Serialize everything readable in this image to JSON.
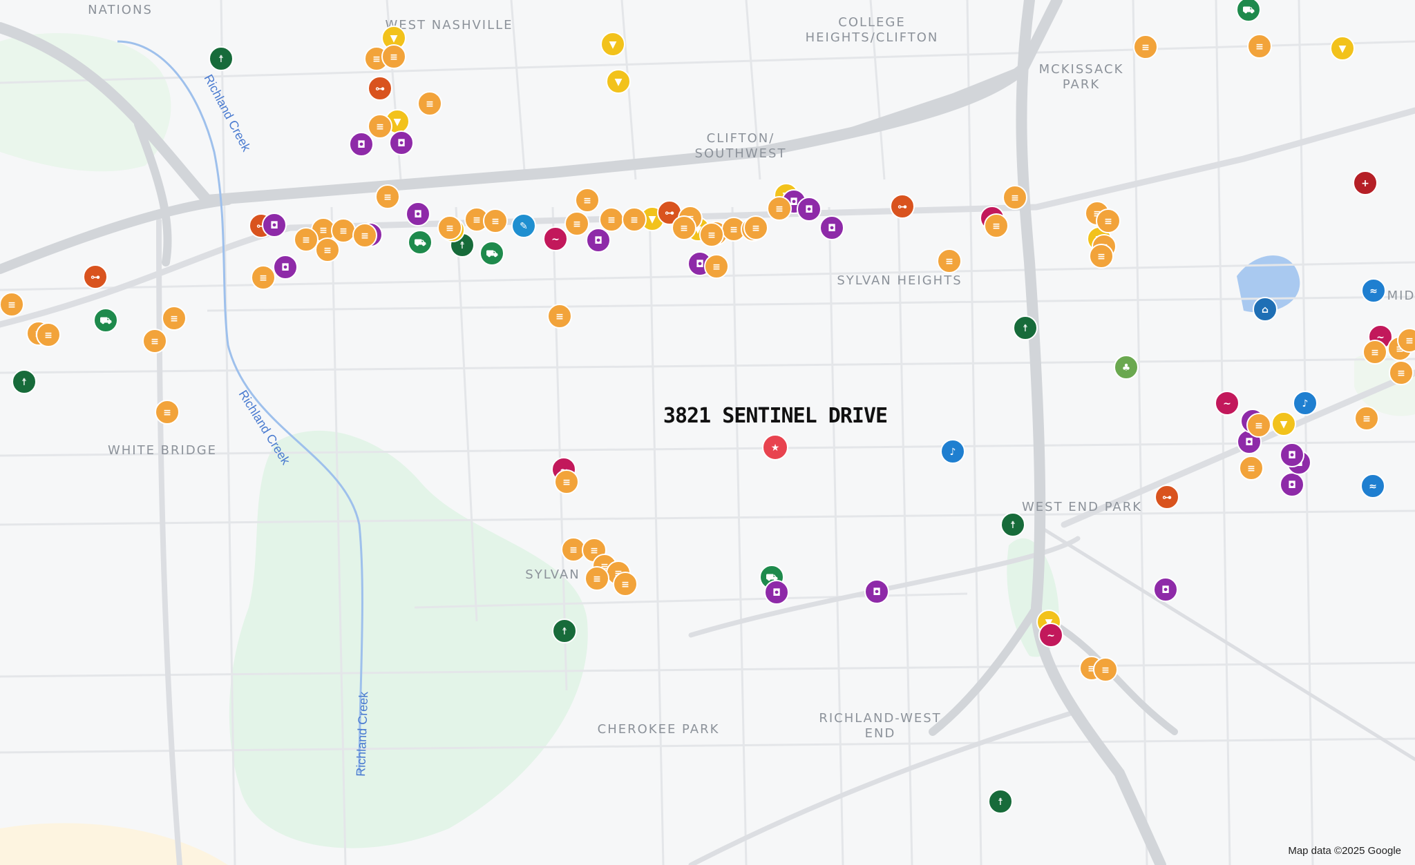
{
  "neighborhoods": [
    {
      "id": "nations",
      "lines": [
        "NATIONS"
      ]
    },
    {
      "id": "west-nashville",
      "lines": [
        "WEST NASHVILLE"
      ]
    },
    {
      "id": "college-heights",
      "lines": [
        "COLLEGE",
        "HEIGHTS/CLIFTON"
      ]
    },
    {
      "id": "mckissack-park",
      "lines": [
        "MCKISSACK",
        "PARK"
      ]
    },
    {
      "id": "clifton-southwest",
      "lines": [
        "CLIFTON/",
        "SOUTHWEST"
      ]
    },
    {
      "id": "sylvan-heights",
      "lines": [
        "SYLVAN HEIGHTS"
      ]
    },
    {
      "id": "white-bridge",
      "lines": [
        "WHITE BRIDGE"
      ]
    },
    {
      "id": "west-end-park",
      "lines": [
        "WEST END PARK"
      ]
    },
    {
      "id": "sylvan",
      "lines": [
        "SYLVAN"
      ]
    },
    {
      "id": "cherokee-park",
      "lines": [
        "CHEROKEE PARK"
      ]
    },
    {
      "id": "richland-west-end",
      "lines": [
        "RICHLAND-WEST",
        "END"
      ]
    },
    {
      "id": "mid",
      "lines": [
        "MID"
      ]
    }
  ],
  "waterways": [
    {
      "id": "creek-1",
      "label": "Richland Creek"
    },
    {
      "id": "creek-2",
      "label": "Richland Creek"
    },
    {
      "id": "creek-3",
      "label": "Richland Creek"
    }
  ],
  "address_label": "3821 SENTINEL DRIVE",
  "attribution": "Map data ©2025 Google",
  "category_colors": {
    "food": "#f2a33a",
    "shop": "#8e2aa8",
    "grocery": "#1e8a4c",
    "hike": "#176b3a",
    "bar": "#f2c21b",
    "gym": "#d9531e",
    "salon": "#c2185b",
    "art": "#1f8fd0",
    "music": "#1f7fd0",
    "museum": "#1f6fb5",
    "medical": "#b51f26",
    "park": "#6aa84f",
    "swim": "#1f7fd0",
    "home": "#e8434f"
  },
  "category_icons": {
    "food": "fork-knife-icon",
    "shop": "shopping-bag-icon",
    "grocery": "cart-icon",
    "hike": "hiker-icon",
    "bar": "cocktail-icon",
    "gym": "dumbbell-icon",
    "salon": "mustache-icon",
    "art": "palette-icon",
    "music": "music-note-icon",
    "museum": "museum-icon",
    "medical": "medical-cross-icon",
    "park": "paw-icon",
    "swim": "swimmer-icon",
    "home": "star-icon"
  }
}
